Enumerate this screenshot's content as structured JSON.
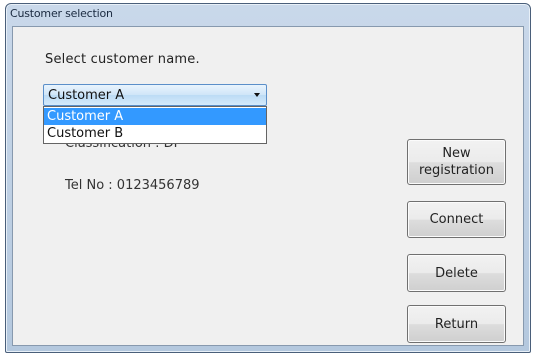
{
  "window": {
    "title": "Customer selection"
  },
  "main": {
    "instruction": "Select customer name.",
    "customer_select": {
      "selected_value": "Customer A",
      "options": [
        "Customer A",
        "Customer B"
      ]
    },
    "classification_text": "Classification : DP",
    "tel_text": "Tel No : 0123456789"
  },
  "buttons": {
    "new_registration": "New\nregistration",
    "connect": "Connect",
    "delete": "Delete",
    "return": "Return"
  },
  "colors": {
    "highlight": "#3399ff",
    "window_frame": "#b4c8de"
  }
}
